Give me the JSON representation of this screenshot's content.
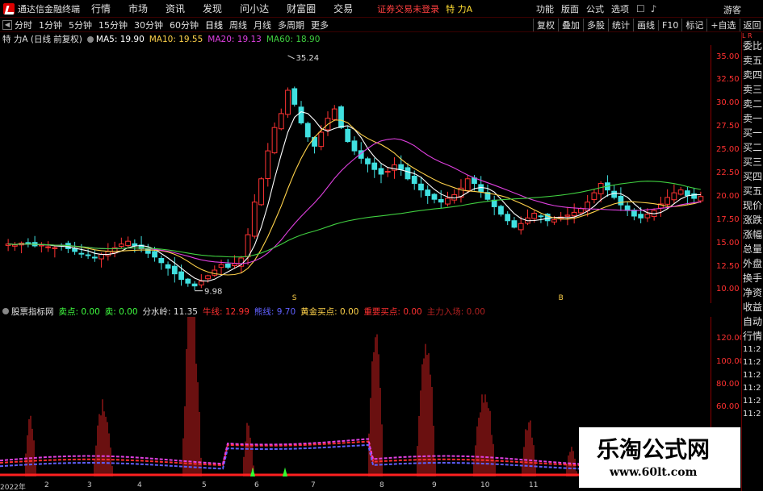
{
  "menubar": {
    "app_title": "通达信金融终端",
    "items": [
      "行情",
      "市场",
      "资讯",
      "发现",
      "问小达",
      "财富圈",
      "交易"
    ],
    "status_msg": "证券交易未登录",
    "stock_title": "特 力A",
    "right_items": [
      "功能",
      "版面",
      "公式",
      "选项"
    ],
    "guest": "游客"
  },
  "toolbar": {
    "periods": [
      "分时",
      "1分钟",
      "5分钟",
      "15分钟",
      "30分钟",
      "60分钟",
      "日线",
      "周线",
      "月线",
      "多周期",
      "更多"
    ],
    "active_period": "日线",
    "right_buttons": [
      "复权",
      "叠加",
      "多股",
      "统计",
      "画线",
      "F10",
      "标记",
      "+自选",
      "返回"
    ]
  },
  "chart_info": {
    "name": "特 力A (日线 前复权)",
    "ma5": "MA5: 19.90",
    "ma10": "MA10: 19.55",
    "ma20": "MA20: 19.13",
    "ma60": "MA60: 18.90",
    "colors": {
      "ma5": "#ffffff",
      "ma10": "#ffd24a",
      "ma20": "#e040e0",
      "ma60": "#40d040"
    }
  },
  "annotations": {
    "high": "35.24",
    "low": "9.98"
  },
  "markers": [
    {
      "text": "S",
      "color": "#ffd24a"
    },
    {
      "text": "B",
      "color": "#ffd24a"
    }
  ],
  "price_axis": [
    "35.00",
    "32.50",
    "30.00",
    "27.50",
    "25.00",
    "22.50",
    "20.00",
    "17.50",
    "15.00",
    "12.50",
    "10.00"
  ],
  "indicator_info": {
    "name": "股票指标网",
    "items": [
      {
        "text": "卖点: 0.00",
        "color": "#40ff40"
      },
      {
        "text": "卖: 0.00",
        "color": "#40ff40"
      },
      {
        "text": "分水岭: 11.35",
        "color": "#e0e0e0"
      },
      {
        "text": "牛线: 12.99",
        "color": "#ff3030"
      },
      {
        "text": "熊线: 9.70",
        "color": "#6060ff"
      },
      {
        "text": "黄金买点: 0.00",
        "color": "#ffd24a"
      },
      {
        "text": "重要买点: 0.00",
        "color": "#ff3030"
      },
      {
        "text": "主力入场: 0.00",
        "color": "#b02020"
      }
    ]
  },
  "indicator_axis": [
    "120.00",
    "100.00",
    "80.00",
    "60.00"
  ],
  "date_labels": [
    "2022年",
    "2",
    "3",
    "4",
    "5",
    "6",
    "7",
    "8",
    "9",
    "10",
    "11"
  ],
  "sidepanel": {
    "head": "L R",
    "items": [
      "委比",
      "卖五",
      "卖四",
      "卖三",
      "卖二",
      "卖一",
      "买一",
      "买二",
      "买三",
      "买四",
      "买五",
      "现价",
      "涨跌",
      "涨幅",
      "总量",
      "外盘",
      "换手",
      "净资",
      "收益",
      "自动",
      "行情"
    ],
    "times": [
      "11:2",
      "11:2",
      "11:2",
      "11:2",
      "11:2",
      "11:2"
    ]
  },
  "watermark": {
    "title": "乐淘公式网",
    "url": "www.60lt.com"
  },
  "chart_data": {
    "type": "candlestick",
    "price_range": [
      9.0,
      36.0
    ],
    "closes": [
      15.0,
      14.9,
      15.1,
      15.0,
      14.8,
      14.9,
      14.7,
      14.6,
      14.8,
      14.5,
      14.2,
      14.0,
      13.8,
      13.5,
      13.9,
      14.2,
      14.6,
      15.0,
      15.3,
      14.8,
      14.5,
      14.0,
      13.6,
      13.0,
      12.4,
      11.8,
      11.2,
      10.8,
      10.5,
      11.0,
      11.6,
      12.2,
      12.8,
      12.5,
      12.9,
      13.5,
      16.0,
      19.5,
      22.0,
      25.0,
      27.5,
      29.0,
      31.5,
      30.0,
      28.0,
      26.5,
      25.5,
      27.0,
      28.5,
      29.5,
      27.5,
      26.0,
      25.0,
      24.2,
      23.6,
      23.0,
      22.5,
      22.8,
      23.5,
      23.0,
      22.0,
      21.5,
      20.8,
      20.2,
      19.8,
      19.5,
      19.9,
      20.3,
      21.0,
      22.0,
      21.5,
      20.6,
      19.8,
      19.0,
      18.2,
      17.5,
      16.8,
      17.2,
      17.8,
      18.3,
      18.0,
      17.5,
      17.6,
      17.9,
      18.1,
      18.4,
      18.8,
      19.5,
      20.5,
      21.5,
      20.8,
      20.0,
      19.2,
      18.6,
      18.0,
      17.8,
      18.2,
      18.6,
      19.3,
      20.0,
      20.5,
      20.8,
      20.2,
      19.9,
      20.1
    ],
    "ma_periods": [
      5,
      10,
      20,
      60
    ],
    "indicator_range": [
      0,
      140
    ]
  }
}
